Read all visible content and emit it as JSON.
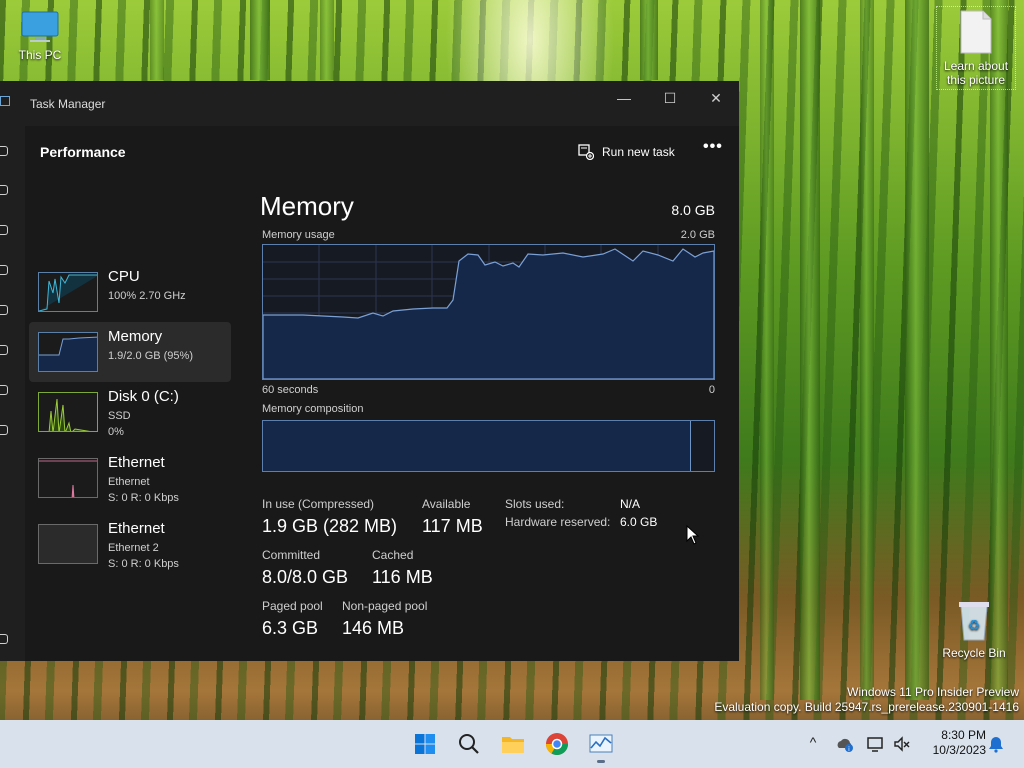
{
  "desktop": {
    "this_pc": "This PC",
    "learn_about": "Learn about this picture",
    "recycle_bin": "Recycle Bin",
    "watermark_line1": "Windows 11 Pro Insider Preview",
    "watermark_line2": "Evaluation copy. Build 25947.rs_prerelease.230901-1416"
  },
  "window": {
    "title": "Task Manager",
    "minimize": "—",
    "maximize": "☐",
    "close": "✕"
  },
  "header": {
    "title": "Performance",
    "run_new_task": "Run new task",
    "more": "•••"
  },
  "perf_list": [
    {
      "name": "CPU",
      "sub1": "100% 2.70 GHz",
      "sub2": ""
    },
    {
      "name": "Memory",
      "sub1": "1.9/2.0 GB (95%)",
      "sub2": ""
    },
    {
      "name": "Disk 0 (C:)",
      "sub1": "SSD",
      "sub2": "0%"
    },
    {
      "name": "Ethernet",
      "sub1": "Ethernet",
      "sub2": "S: 0 R: 0 Kbps"
    },
    {
      "name": "Ethernet",
      "sub1": "Ethernet 2",
      "sub2": "S: 0 R: 0 Kbps"
    }
  ],
  "memory": {
    "title": "Memory",
    "total": "8.0 GB",
    "usage_label": "Memory usage",
    "usage_max": "2.0 GB",
    "time_left": "60 seconds",
    "time_right": "0",
    "composition_label": "Memory composition",
    "in_use_label": "In use (Compressed)",
    "in_use_value": "1.9 GB (282 MB)",
    "available_label": "Available",
    "available_value": "117 MB",
    "slots_label": "Slots used:",
    "slots_value": "N/A",
    "hw_reserved_label": "Hardware reserved:",
    "hw_reserved_value": "6.0 GB",
    "committed_label": "Committed",
    "committed_value": "8.0/8.0 GB",
    "cached_label": "Cached",
    "cached_value": "116 MB",
    "paged_label": "Paged pool",
    "paged_value": "6.3 GB",
    "nonpaged_label": "Non-paged pool",
    "nonpaged_value": "146 MB"
  },
  "taskbar": {
    "time": "8:30 PM",
    "date": "10/3/2023",
    "tray_chevron": "^"
  },
  "colors": {
    "accent": "#5d7fae",
    "graph_fill": "#15284a"
  }
}
